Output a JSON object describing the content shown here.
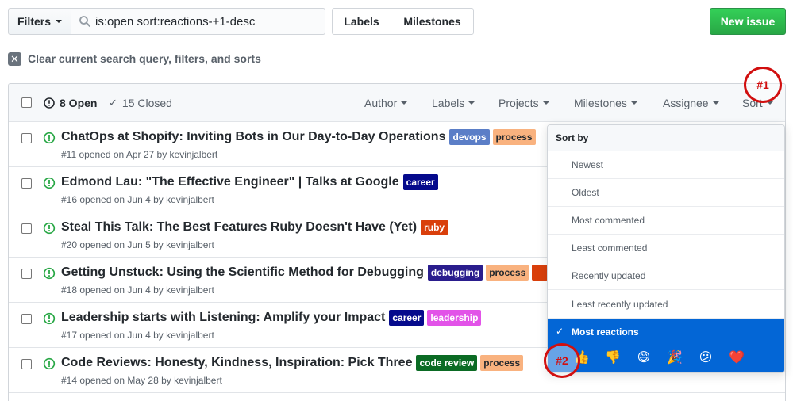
{
  "toolbar": {
    "filters_label": "Filters",
    "search_value": "is:open sort:reactions-+1-desc",
    "labels_label": "Labels",
    "milestones_label": "Milestones",
    "new_issue_label": "New issue"
  },
  "clear_label": "Clear current search query, filters, and sorts",
  "header": {
    "open_count": "8 Open",
    "closed_count": "15 Closed",
    "menus": [
      "Author",
      "Labels",
      "Projects",
      "Milestones",
      "Assignee",
      "Sort"
    ]
  },
  "issues": [
    {
      "title": "ChatOps at Shopify: Inviting Bots in Our Day-to-Day Operations",
      "meta": "#11 opened on Apr 27 by kevinjalbert",
      "labels": [
        {
          "name": "devops",
          "bg": "#5b7ec7",
          "fg": "#ffffff"
        },
        {
          "name": "process",
          "bg": "#f9b27f",
          "fg": "#24292e"
        }
      ]
    },
    {
      "title": "Edmond Lau: \"The Effective Engineer\" | Talks at Google",
      "meta": "#16 opened on Jun 4 by kevinjalbert",
      "labels": [
        {
          "name": "career",
          "bg": "#050a8c",
          "fg": "#ffffff"
        }
      ]
    },
    {
      "title": "Steal This Talk: The Best Features Ruby Doesn't Have (Yet)",
      "meta": "#20 opened on Jun 5 by kevinjalbert",
      "labels": [
        {
          "name": "ruby",
          "bg": "#d93f0b",
          "fg": "#ffffff"
        }
      ]
    },
    {
      "title": "Getting Unstuck: Using the Scientific Method for Debugging",
      "meta": "#18 opened on Jun 4 by kevinjalbert",
      "labels": [
        {
          "name": "debugging",
          "bg": "#2a1d8d",
          "fg": "#ffffff"
        },
        {
          "name": "process",
          "bg": "#f9b27f",
          "fg": "#24292e"
        },
        {
          "name": "",
          "bg": "#d93f0b",
          "fg": "#ffffff"
        }
      ]
    },
    {
      "title": "Leadership starts with Listening: Amplify your Impact",
      "meta": "#17 opened on Jun 4 by kevinjalbert",
      "labels": [
        {
          "name": "career",
          "bg": "#050a8c",
          "fg": "#ffffff"
        },
        {
          "name": "leadership",
          "bg": "#e253e8",
          "fg": "#ffffff"
        }
      ]
    },
    {
      "title": "Code Reviews: Honesty, Kindness, Inspiration: Pick Three",
      "meta": "#14 opened on May 28 by kevinjalbert",
      "labels": [
        {
          "name": "code review",
          "bg": "#0b6b24",
          "fg": "#ffffff"
        },
        {
          "name": "process",
          "bg": "#f9b27f",
          "fg": "#24292e"
        }
      ]
    }
  ],
  "sort_menu": {
    "header": "Sort by",
    "options": [
      "Newest",
      "Oldest",
      "Most commented",
      "Least commented",
      "Recently updated",
      "Least recently updated"
    ],
    "selected": "Most reactions",
    "reactions": [
      "👍",
      "👎",
      "😄",
      "🎉",
      "😕",
      "❤️"
    ]
  },
  "annotations": [
    "#1",
    "#2"
  ],
  "colors": {
    "accent": "#0366d6",
    "open_green": "#28a745",
    "annotation_red": "#d10f0f"
  }
}
